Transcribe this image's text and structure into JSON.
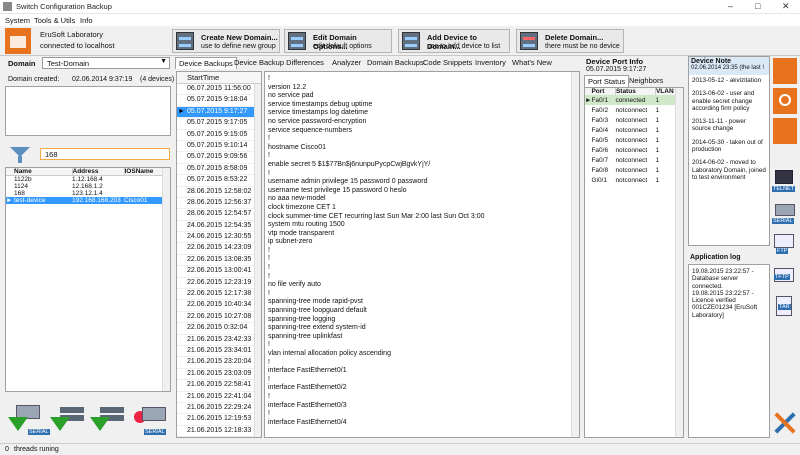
{
  "window": {
    "title": "Switch Configuration Backup"
  },
  "menu": [
    "System",
    "Tools & Utils",
    "Info"
  ],
  "header": {
    "company": "EruSoft Laboratory",
    "connection": "connected to localhost"
  },
  "toolbar": [
    {
      "title": "Create New Domain...",
      "sub": "use to define new group"
    },
    {
      "title": "Edit Domain Options...",
      "sub": "edit default options"
    },
    {
      "title": "Add Device to Domain...",
      "sub": "use to add device to list"
    },
    {
      "title": "Delete Domain...",
      "sub": "there must be no device"
    }
  ],
  "domain": {
    "label": "Domain",
    "selected": "Test-Domain",
    "created_label": "Domain created:",
    "created": "02.06.2014 9:37:19",
    "devices": "(4 devices)"
  },
  "filter": {
    "value": "168"
  },
  "device_table": {
    "columns": [
      "Name",
      "Address",
      "IOSName"
    ],
    "rows": [
      [
        "1122b",
        "1.12.168.4",
        ""
      ],
      [
        "1124",
        "12.168.1.2",
        ""
      ],
      [
        "168",
        "123.12.1.4",
        ""
      ],
      [
        "test-device",
        "192.168.168.203",
        "Cisco01"
      ]
    ]
  },
  "main_tabs": [
    "Device Backups",
    "Device Backup Differences",
    "Analyzer",
    "Domain Backups",
    "Code Snippets",
    "Inventory",
    "What's New"
  ],
  "backups": {
    "header": "StartTime",
    "rows": [
      "06.07.2015 11:56:00",
      "05.07.2015 9:18:04",
      "05.07.2015 9:17:27",
      "05.07.2015 9:17:05",
      "05.07.2015 9:15:05",
      "05.07.2015 9:10:14",
      "05.07.2015 9:09:56",
      "05.07.2015 8:58:09",
      "05.07.2015 8:53:22",
      "28.06.2015 12:58:02",
      "28.06.2015 12:56:37",
      "28.06.2015 12:54:57",
      "24.06.2015 12:54:35",
      "24.06.2015 12:30:55",
      "22.06.2015 14:23:09",
      "22.06.2015 13:08:35",
      "22.06.2015 13:00:41",
      "22.06.2015 12:23:19",
      "22.06.2015 12:17:38",
      "22.06.2015 10:40:34",
      "22.06.2015 10:27:08",
      "22.06.2015 0:32:04",
      "21.06.2015 23:42:33",
      "21.06.2015 23:34:01",
      "21.06.2015 23:20:04",
      "21.06.2015 23:03:09",
      "21.06.2015 22:58:41",
      "21.06.2015 22:41:04",
      "21.06.2015 22:29:24",
      "21.06.2015 12:19:53",
      "21.06.2015 12:18:33"
    ]
  },
  "config_lines": [
    "!",
    "version 12.2",
    "no service pad",
    "service timestamps debug uptime",
    "service timestamps log datetime",
    "no service password-encryption",
    "service sequence-numbers",
    "!",
    "hostname Cisco01",
    "!",
    "enable secret 5 $1$77Bn$j6nunpuPycpCwjBgvkYjY/",
    "!",
    "username admin privilege 15 password 0 password",
    "username test privilege 15 password 0 heslo",
    "no aaa new-model",
    "clock timezone CET 1",
    "clock summer-time CET recurring last Sun Mar 2:00 last Sun Oct 3:00",
    "system mtu routing 1500",
    "vtp mode transparent",
    "ip subnet-zero",
    "!",
    "!",
    "!",
    "!",
    "no file verify auto",
    "!",
    "spanning-tree mode rapid-pvst",
    "spanning-tree loopguard default",
    "spanning-tree logging",
    "spanning-tree extend system-id",
    "spanning-tree uplinkfast",
    "!",
    "vlan internal allocation policy ascending",
    "!",
    "interface FastEthernet0/1",
    "!",
    "interface FastEthernet0/2",
    "!",
    "interface FastEthernet0/3",
    "!",
    "interface FastEthernet0/4"
  ],
  "port_info": {
    "title": "Device Port Info",
    "date": "05.07.2015 9:17:27",
    "tabs": [
      "Port Status",
      "Neighbors"
    ],
    "columns": [
      "Port",
      "Status",
      "VLAN"
    ],
    "rows": [
      [
        "Fa0/1",
        "connected",
        "1"
      ],
      [
        "Fa0/2",
        "notconnect",
        "1"
      ],
      [
        "Fa0/3",
        "notconnect",
        "1"
      ],
      [
        "Fa0/4",
        "notconnect",
        "1"
      ],
      [
        "Fa0/5",
        "notconnect",
        "1"
      ],
      [
        "Fa0/6",
        "notconnect",
        "1"
      ],
      [
        "Fa0/7",
        "notconnect",
        "1"
      ],
      [
        "Fa0/8",
        "notconnect",
        "1"
      ],
      [
        "Gi0/1",
        "notconnect",
        "1"
      ]
    ]
  },
  "device_note": {
    "title": "Device Note",
    "header": "02.06.2014 23:35 (the last !",
    "entries": [
      "2013-05-12 - akvizitation",
      "2013-06-02 - user and enable secret change according firm policy",
      "2013-11-11 - power source change",
      "2014-05-30 - taken out of production",
      "2014-06-02 - moved to Laboratory Domain, joined to test environment"
    ]
  },
  "app_log": {
    "title": "Application log",
    "entries": [
      "19.08.2015 23:22:57 - Database server connected.",
      "19.08.2015 23:22:57 - Licence verified 001CZE01234 [EruSoft Laboratory]"
    ]
  },
  "side_icons": [
    "TELNET",
    "SERIAL",
    "FTP",
    "TFTP",
    "TAR"
  ],
  "bottom_labels": {
    "serial1": "SERIAL",
    "serial2": "SERIAL"
  },
  "status": {
    "text": "threads runing",
    "count": "0"
  }
}
